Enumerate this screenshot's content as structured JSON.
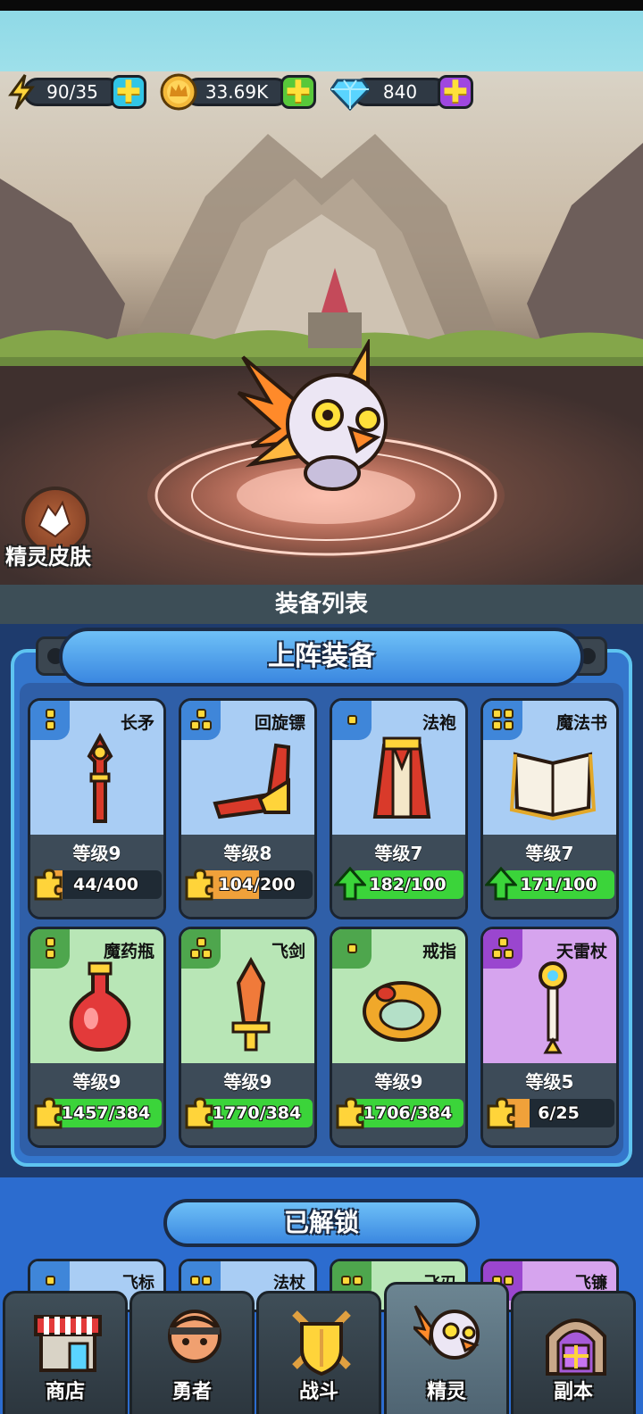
{
  "resources": {
    "energy": {
      "value": "90/35",
      "icon": "lightning-icon"
    },
    "gold": {
      "value": "33.69K",
      "icon": "crown-coin-icon"
    },
    "diamond": {
      "value": "840",
      "icon": "diamond-icon"
    }
  },
  "scene": {
    "skin_button_label": "精灵皮肤"
  },
  "equipment": {
    "list_title": "装备列表",
    "section_title": "上阵装备",
    "cards": [
      {
        "name": "长矛",
        "level": "等级9",
        "progress": "44/400",
        "progress_fraction": 0.11,
        "rarity": "blue",
        "stars": 2,
        "upgradable": false
      },
      {
        "name": "回旋镖",
        "level": "等级8",
        "progress": "104/200",
        "progress_fraction": 0.52,
        "rarity": "blue",
        "stars": 3,
        "upgradable": false
      },
      {
        "name": "法袍",
        "level": "等级7",
        "progress": "182/100",
        "progress_fraction": 1.0,
        "rarity": "blue",
        "stars": 1,
        "upgradable": true
      },
      {
        "name": "魔法书",
        "level": "等级7",
        "progress": "171/100",
        "progress_fraction": 1.0,
        "rarity": "blue",
        "stars": 4,
        "upgradable": true
      },
      {
        "name": "魔药瓶",
        "level": "等级9",
        "progress": "1457/384",
        "progress_fraction": 1.0,
        "rarity": "green",
        "stars": 2,
        "upgradable": false
      },
      {
        "name": "飞剑",
        "level": "等级9",
        "progress": "1770/384",
        "progress_fraction": 1.0,
        "rarity": "green",
        "stars": 3,
        "upgradable": false
      },
      {
        "name": "戒指",
        "level": "等级9",
        "progress": "1706/384",
        "progress_fraction": 1.0,
        "rarity": "green",
        "stars": 1,
        "upgradable": false
      },
      {
        "name": "天雷杖",
        "level": "等级5",
        "progress": "6/25",
        "progress_fraction": 0.24,
        "rarity": "purple",
        "stars": 3,
        "upgradable": false
      }
    ]
  },
  "unlocked": {
    "title": "已解锁",
    "items": [
      {
        "name": "飞标",
        "rarity": "blue"
      },
      {
        "name": "法杖",
        "rarity": "blue"
      },
      {
        "name": "飞刃",
        "rarity": "green"
      },
      {
        "name": "飞镰",
        "rarity": "purple"
      }
    ]
  },
  "nav": {
    "tabs": [
      {
        "label": "商店",
        "icon": "shop-icon"
      },
      {
        "label": "勇者",
        "icon": "hero-icon"
      },
      {
        "label": "战斗",
        "icon": "battle-shield-icon"
      },
      {
        "label": "精灵",
        "icon": "spirit-icon",
        "active": true
      },
      {
        "label": "副本",
        "icon": "dungeon-gate-icon"
      }
    ]
  },
  "colors": {
    "blue_card": "#a9cdf4",
    "green_card": "#b8e6b6",
    "purple_card": "#d6a4ee",
    "progress_green": "#3bd43a",
    "progress_orange": "#f0a13a"
  }
}
